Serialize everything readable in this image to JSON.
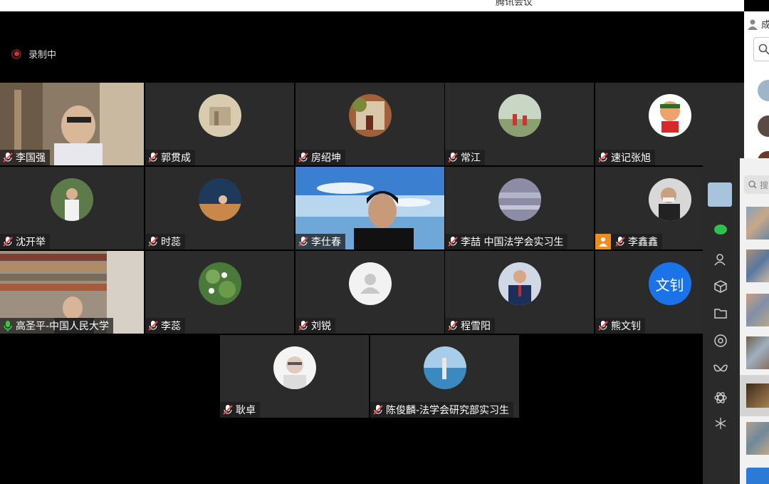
{
  "app": {
    "title": "腾讯会议"
  },
  "recording": {
    "label": "录制中"
  },
  "tiles": [
    {
      "name": "李国强"
    },
    {
      "name": "郭贯成"
    },
    {
      "name": "房绍坤"
    },
    {
      "name": "常江"
    },
    {
      "name": "速记张旭"
    },
    {
      "name": "沈开举"
    },
    {
      "name": "时蕊"
    },
    {
      "name": "李仕春"
    },
    {
      "name": "李喆 中国法学会实习生"
    },
    {
      "name": "李鑫鑫"
    },
    {
      "name": "高圣平-中国人民大学"
    },
    {
      "name": "李蕊"
    },
    {
      "name": "刘锐"
    },
    {
      "name": "程雪阳"
    },
    {
      "name": "熊文钊",
      "avatar_text": "文钊"
    },
    {
      "name": "耿卓"
    },
    {
      "name": "陈俊麟-法学会研究部实习生"
    }
  ],
  "right_panel": {
    "header_partial": "成",
    "search_partial": "搜"
  },
  "colors": {
    "tile_bg": "#2b2b2b",
    "accent_blue": "#1a73e8",
    "mic_red": "#e84b4b",
    "mic_green": "#2ecc40"
  }
}
